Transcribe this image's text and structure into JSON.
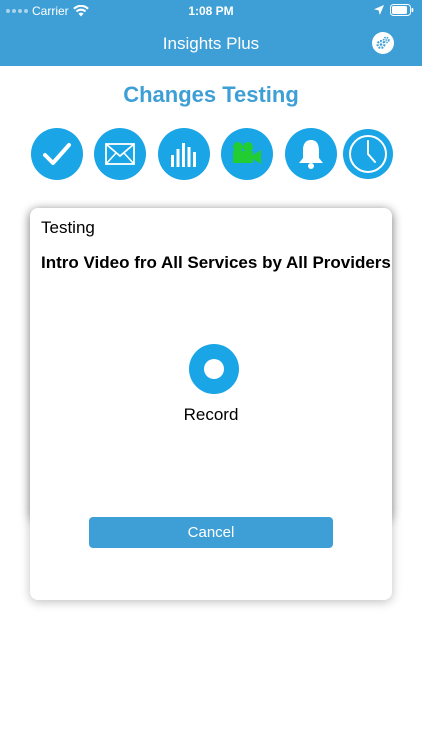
{
  "status_bar": {
    "carrier": "Carrier",
    "time": "1:08 PM",
    "icons": [
      "signal-dots-icon",
      "wifi-icon",
      "location-arrow-icon",
      "battery-icon"
    ]
  },
  "nav": {
    "title": "Insights Plus",
    "settings_icon": "gear-icon"
  },
  "page": {
    "title": "Changes Testing"
  },
  "category_icons": [
    {
      "name": "checkmark-icon",
      "color": "#1aa5e6"
    },
    {
      "name": "envelope-icon",
      "color": "#1aa5e6"
    },
    {
      "name": "bar-chart-icon",
      "color": "#1aa5e6"
    },
    {
      "name": "video-camera-icon",
      "color": "#1aa5e6",
      "glyph_color": "#22cc33"
    },
    {
      "name": "bell-icon",
      "color": "#1aa5e6"
    },
    {
      "name": "clock-icon",
      "color": "#1aa5e6"
    }
  ],
  "dialog": {
    "header": "Testing",
    "subtitle": "Intro Video fro All Services by All Providers",
    "record_label": "Record",
    "cancel_label": "Cancel"
  },
  "colors": {
    "brand_blue": "#3e9fd6",
    "icon_blue": "#1aa5e6",
    "video_green": "#22cc33"
  }
}
